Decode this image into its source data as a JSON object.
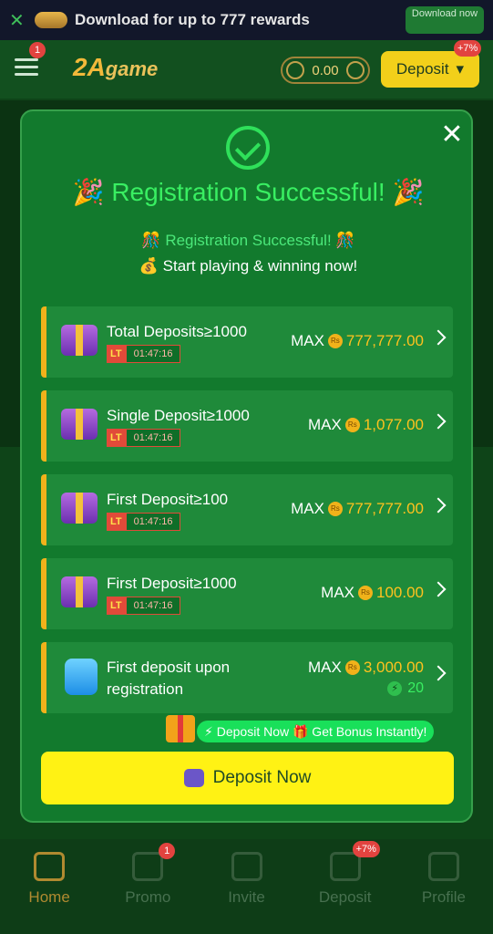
{
  "banner": {
    "text": "Download for up to 777 rewards",
    "button": "Download now"
  },
  "header": {
    "menu_badge": "1",
    "balance": "0.00",
    "deposit_label": "Deposit",
    "deposit_badge": "+7%"
  },
  "modal": {
    "title": "Registration Successful!",
    "subtitle": "Registration Successful!",
    "tagline": "Start playing & winning now!",
    "rows": [
      {
        "title": "Total Deposits≥1000",
        "lt": "LT",
        "timer": "01:47:16",
        "max": "MAX",
        "value": "777,777.00"
      },
      {
        "title": "Single Deposit≥1000",
        "lt": "LT",
        "timer": "01:47:16",
        "max": "MAX",
        "value": "1,077.00"
      },
      {
        "title": "First Deposit≥100",
        "lt": "LT",
        "timer": "01:47:16",
        "max": "MAX",
        "value": "777,777.00"
      },
      {
        "title": "First Deposit≥1000",
        "lt": "LT",
        "timer": "01:47:16",
        "max": "MAX",
        "value": "100.00"
      },
      {
        "title": "First deposit upon registration",
        "max": "MAX",
        "value": "3,000.00",
        "bonus": "20"
      }
    ],
    "promo_pill": "Deposit Now 🎁 Get Bonus Instantly!",
    "cta": "Deposit Now"
  },
  "nav": {
    "items": [
      {
        "label": "Home"
      },
      {
        "label": "Promo",
        "badge": "1"
      },
      {
        "label": "Invite"
      },
      {
        "label": "Deposit",
        "badge": "+7%"
      },
      {
        "label": "Profile"
      }
    ]
  }
}
